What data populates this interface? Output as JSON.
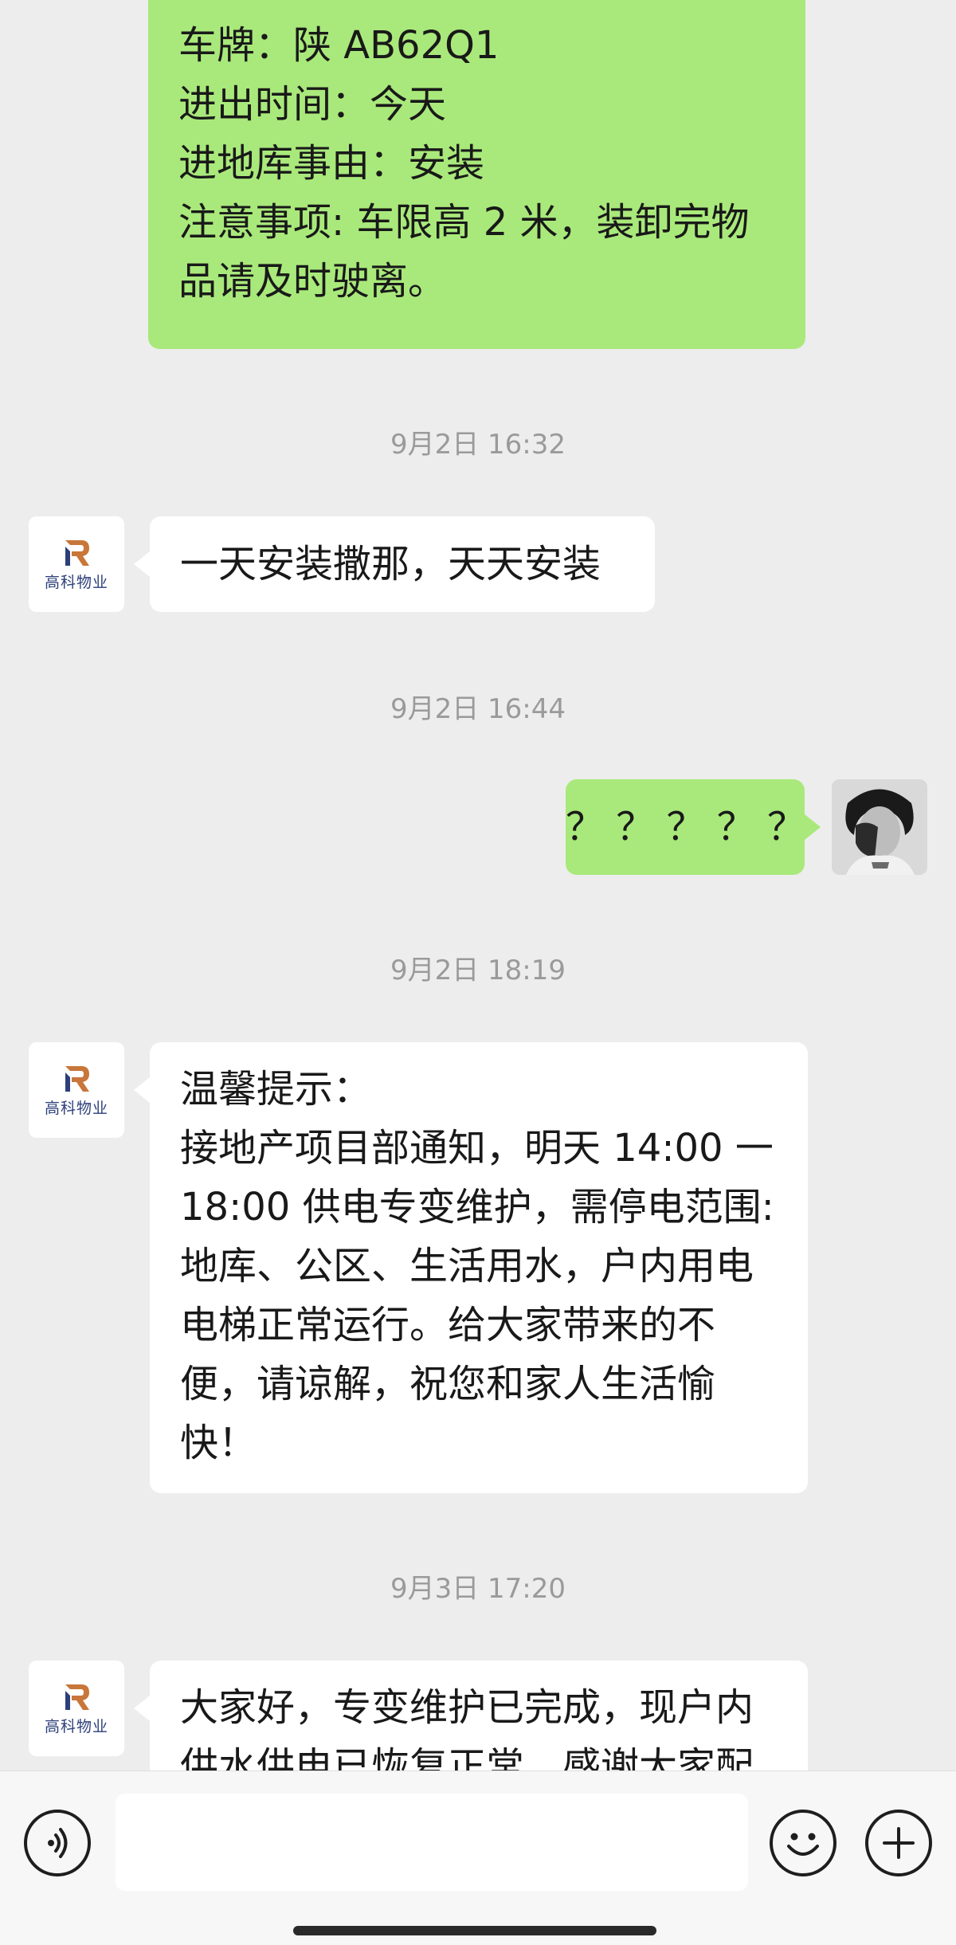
{
  "messages": {
    "top_green": {
      "lines": [
        "车牌：陕 AB62Q1",
        "进出时间：今天",
        "进地库事由：安装",
        "注意事项: 车限高 2 米，装卸完物",
        "品请及时驶离。"
      ]
    },
    "t1": "9月2日 16:32",
    "m1": {
      "text": "一天安装撒那，天天安装"
    },
    "t2": "9月2日 16:44",
    "m2": {
      "text": "？ ？ ？ ？ ？"
    },
    "t3": "9月2日 18:19",
    "m3": {
      "lines": [
        "温馨提示：",
        "接地产项目部通知，明天 14:00 一",
        "18:00 供电专变维护，需停电范围:",
        "地库、公区、生活用水，户内用电",
        "电梯正常运行。给大家带来的不",
        "便，请谅解，祝您和家人生活愉",
        "快！"
      ]
    },
    "t4": "9月3日 17:20",
    "m4": {
      "lines": [
        "大家好，专变维护已完成，现户内",
        "供水供电已恢复正常，感谢大家配"
      ]
    }
  },
  "contact": {
    "brand": "高科物业"
  },
  "colors": {
    "sent_bubble": "#a9e97b",
    "received_bubble": "#ffffff",
    "background": "#ededed"
  },
  "icons": {
    "voice": "voice-icon",
    "emoji": "emoji-icon",
    "add": "plus-icon"
  }
}
